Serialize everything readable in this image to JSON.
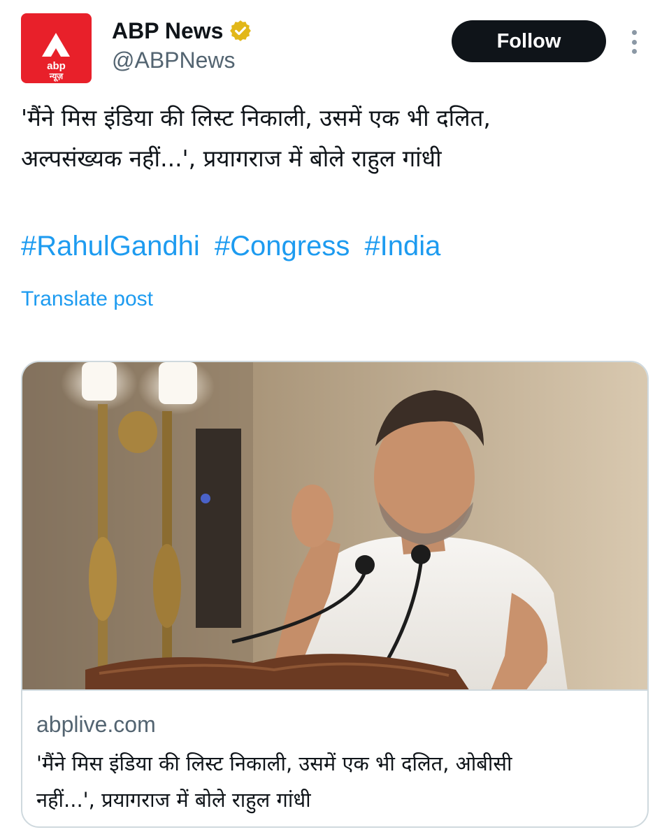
{
  "header": {
    "avatar_logo_text": "abp",
    "avatar_logo_subtext": "न्यूज़",
    "display_name": "ABP News",
    "handle": "@ABPNews",
    "follow_label": "Follow",
    "verified_color": "#e2b719"
  },
  "post": {
    "text_line1": "'मैंने मिस इंडिया की लिस्ट निकाली, उसमें एक भी दलित,",
    "text_line2": "अल्पसंख्यक नहीं...', प्रयागराज में बोले राहुल गांधी",
    "hashtags": [
      "#RahulGandhi",
      "#Congress",
      "#India"
    ],
    "translate_label": "Translate post",
    "link_color": "#1d9bf0"
  },
  "card": {
    "domain": "abplive.com",
    "title_line1": "'मैंने मिस इंडिया की लिस्ट निकाली, उसमें एक भी दलित, ओबीसी",
    "title_line2": "नहीं...', प्रयागराज में बोले राहुल गांधी"
  },
  "icons": {
    "verified": "verified-badge-icon",
    "more": "more-vertical-icon"
  }
}
